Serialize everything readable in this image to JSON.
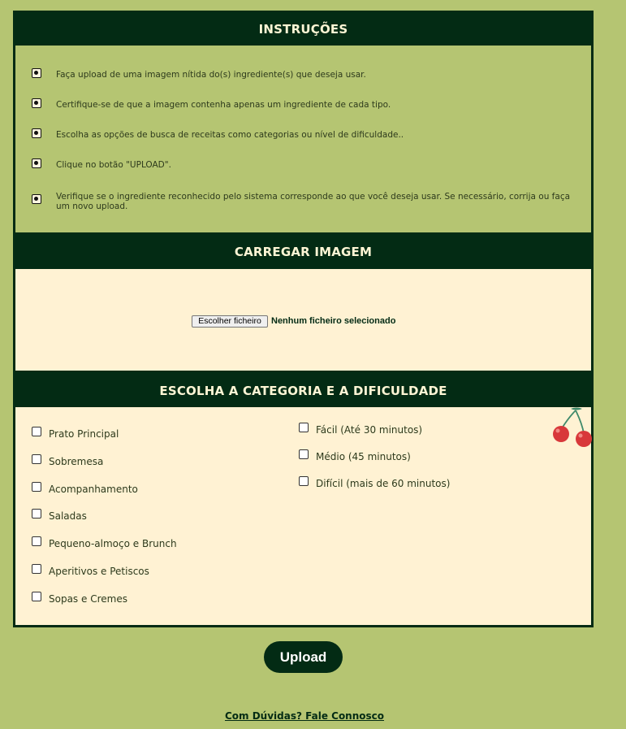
{
  "instructions": {
    "title": "INSTRUÇÕES",
    "items": [
      "Faça upload de uma imagem nítida do(s) ingrediente(s) que deseja usar.",
      "Certifique-se de que a imagem contenha apenas um ingrediente de cada tipo.",
      "Escolha as opções de busca de receitas como categorias ou nível de dificuldade..",
      "Clique no botão \"UPLOAD\".",
      "Verifique se o ingrediente reconhecido pelo sistema corresponde ao que você deseja usar. Se necessário, corrija ou faça um novo upload."
    ]
  },
  "upload_section": {
    "title": "CARREGAR IMAGEM",
    "file_button": "Escolher ficheiro",
    "file_status": "Nenhum ficheiro selecionado"
  },
  "category_section": {
    "title": "ESCOLHA A CATEGORIA E A DIFICULDADE",
    "categories": [
      "Prato Principal",
      "Sobremesa",
      "Acompanhamento",
      "Saladas",
      "Pequeno-almoço e Brunch",
      "Aperitivos e Petiscos",
      "Sopas e Cremes"
    ],
    "difficulties": [
      "Fácil (Até 30 minutos)",
      "Médio (45 minutos)",
      "Difícil (mais de 60 minutos)"
    ],
    "decoration_icon": "cherry-icon"
  },
  "actions": {
    "upload_label": "Upload",
    "contact_link": "Com Dúvidas? Fale Connosco"
  },
  "colors": {
    "page_background": "#b5c572",
    "dark_green": "#032b14",
    "cream": "#fff2d3",
    "cherry_red": "#d8383a"
  }
}
